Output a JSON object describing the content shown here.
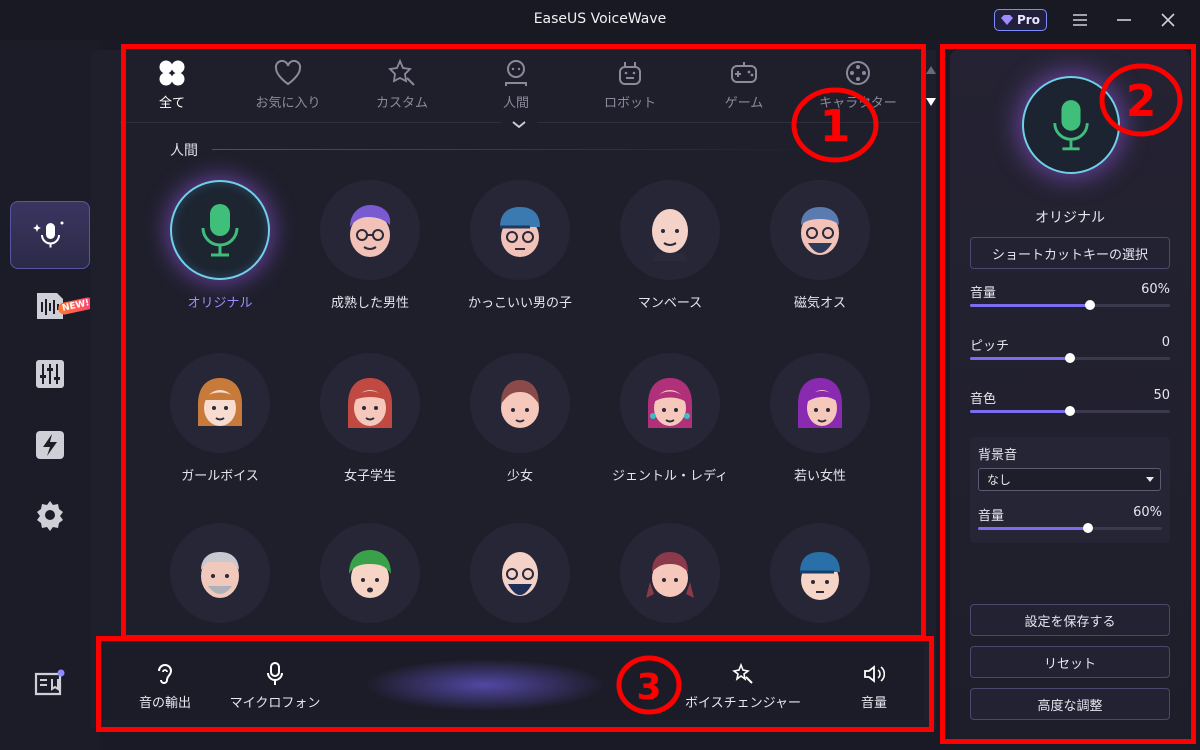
{
  "app": {
    "title": "EaseUS VoiceWave",
    "pro_label": "Pro"
  },
  "colors": {
    "accent": "#7b6cf0",
    "selected_text": "#9b8cff",
    "annotation": "#ff0000",
    "mic_green": "#3fbf7a"
  },
  "rail": {
    "items": [
      {
        "name": "voice-changer",
        "icon": "sparkle-mic-icon",
        "active": true
      },
      {
        "name": "audio",
        "icon": "waveform-card-icon"
      },
      {
        "name": "mixer",
        "icon": "sliders-icon",
        "badge": "NEW!"
      },
      {
        "name": "quick",
        "icon": "lightning-icon"
      },
      {
        "name": "settings",
        "icon": "gear-icon"
      },
      {
        "name": "guide",
        "icon": "book-icon"
      }
    ],
    "new_badge": "NEW!"
  },
  "tabs": [
    {
      "label": "全て",
      "icon": "clover-icon",
      "active": true
    },
    {
      "label": "お気に入り",
      "icon": "heart-icon"
    },
    {
      "label": "カスタム",
      "icon": "custom-star-icon"
    },
    {
      "label": "人間",
      "icon": "person-icon"
    },
    {
      "label": "ロボット",
      "icon": "robot-icon"
    },
    {
      "label": "ゲーム",
      "icon": "gamepad-icon"
    },
    {
      "label": "キャラクター",
      "icon": "film-reel-icon"
    }
  ],
  "section": {
    "title": "人間"
  },
  "voices": [
    {
      "label": "オリジナル",
      "icon": "microphone-icon",
      "selected": true
    },
    {
      "label": "成熟した男性",
      "icon": "man-glasses-purple-icon"
    },
    {
      "label": "かっこいい男の子",
      "icon": "boy-cap-icon"
    },
    {
      "label": "マンベース",
      "icon": "bald-man-icon"
    },
    {
      "label": "磁気オス",
      "icon": "bearded-man-icon"
    },
    {
      "label": "ガールボイス",
      "icon": "girl-bangs-icon"
    },
    {
      "label": "女子学生",
      "icon": "schoolgirl-icon"
    },
    {
      "label": "少女",
      "icon": "little-girl-icon"
    },
    {
      "label": "ジェントル・レディ",
      "icon": "lady-pink-icon"
    },
    {
      "label": "若い女性",
      "icon": "young-woman-purple-icon"
    },
    {
      "label": "",
      "icon": "old-man-icon"
    },
    {
      "label": "",
      "icon": "green-kid-icon"
    },
    {
      "label": "",
      "icon": "bald-bearded-man-icon"
    },
    {
      "label": "",
      "icon": "pigtail-girl-icon"
    },
    {
      "label": "",
      "icon": "cap-boy-icon"
    }
  ],
  "panel": {
    "voice_name": "オリジナル",
    "shortcut_button": "ショートカットキーの選択",
    "sliders": [
      {
        "label": "音量",
        "value_text": "60%",
        "fraction": 0.6
      },
      {
        "label": "ピッチ",
        "value_text": "0",
        "fraction": 0.5
      },
      {
        "label": "音色",
        "value_text": "50",
        "fraction": 0.5
      }
    ],
    "background": {
      "title": "背景音",
      "selected": "なし",
      "volume_label": "音量",
      "volume_text": "60%",
      "volume_fraction": 0.6
    },
    "save_button": "設定を保存する",
    "reset_button": "リセット",
    "advanced_button": "高度な調整"
  },
  "bottom": {
    "output": "音の輸出",
    "microphone": "マイクロフォン",
    "voice_changer": "ボイスチェンジャー",
    "volume": "音量"
  },
  "annotations": [
    "①",
    "②",
    "③"
  ]
}
